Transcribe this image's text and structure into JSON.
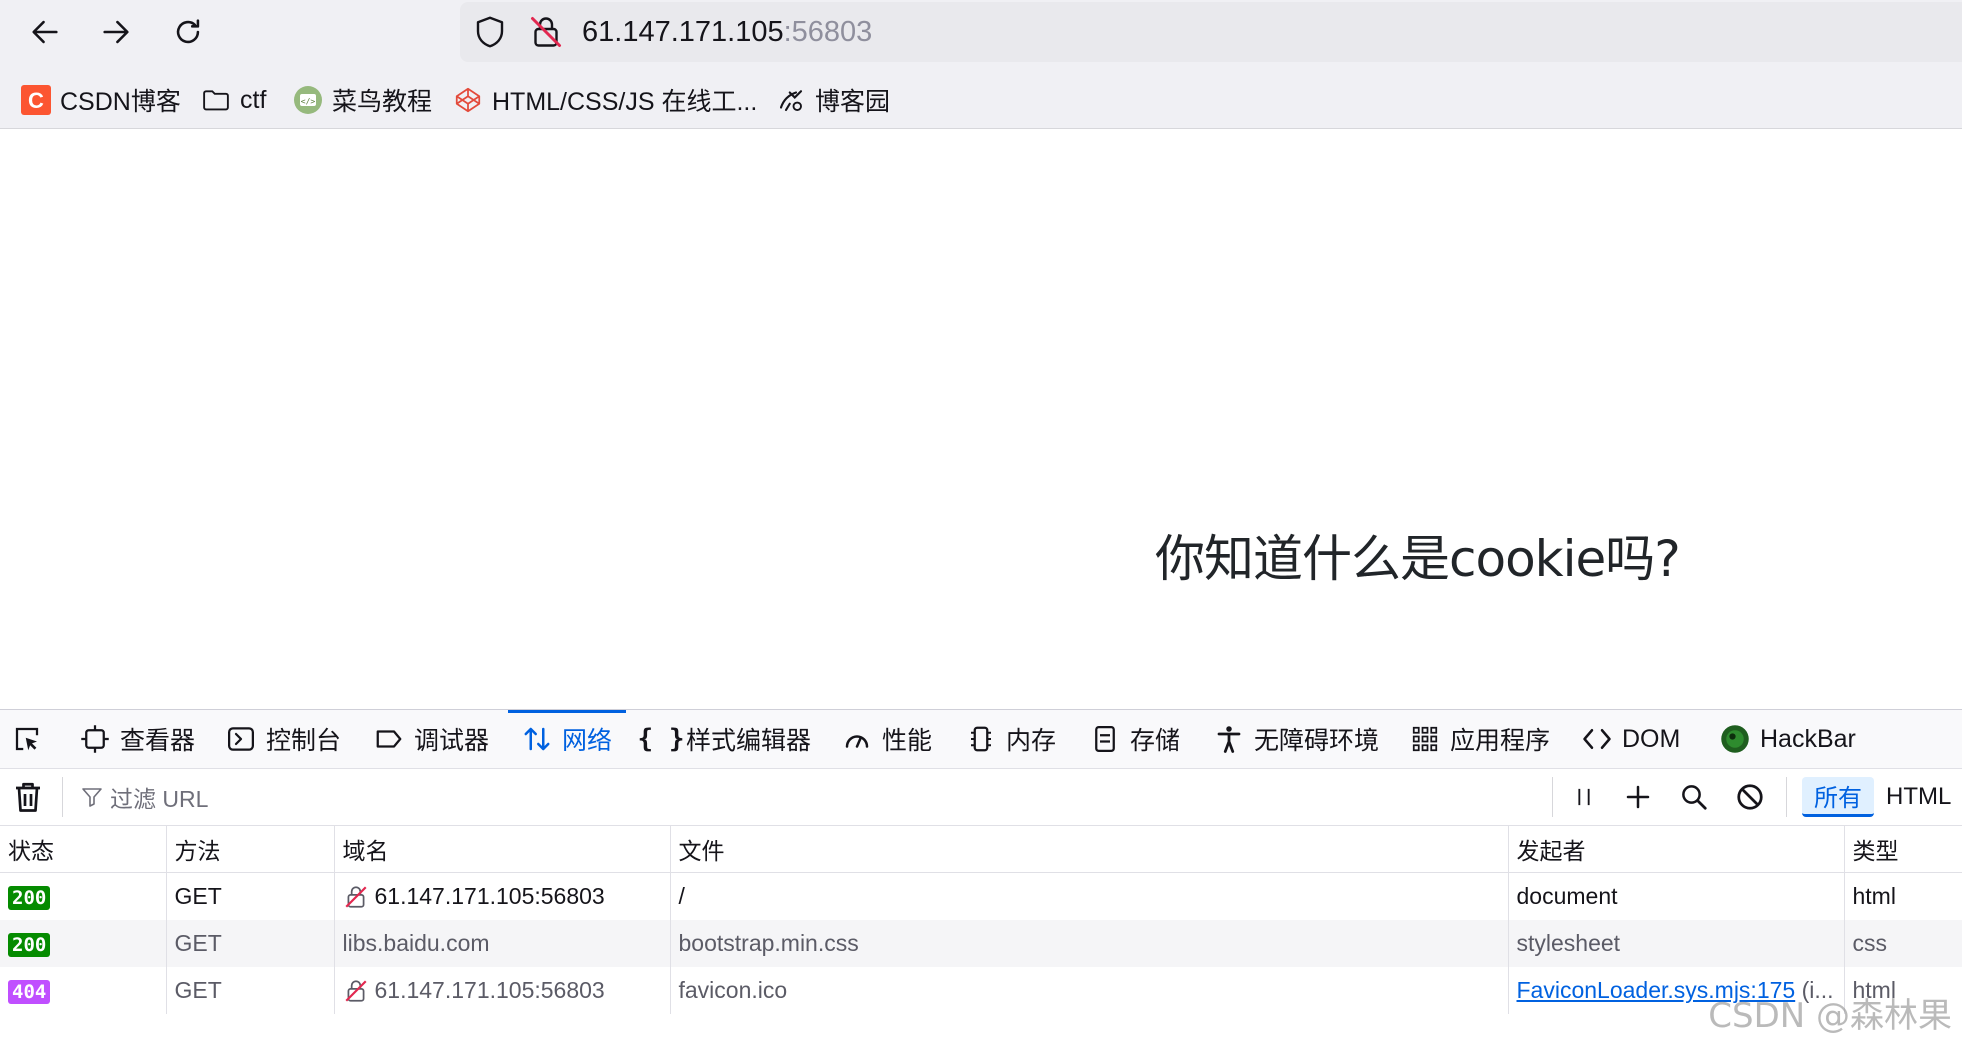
{
  "browser": {
    "url_host": "61.147.171.105",
    "url_port": ":56803",
    "bookmarks": [
      {
        "label": "CSDN博客",
        "icon": "csdn-logo-icon"
      },
      {
        "label": "ctf",
        "icon": "folder-icon"
      },
      {
        "label": "菜鸟教程",
        "icon": "runoob-logo-icon"
      },
      {
        "label": "HTML/CSS/JS 在线工...",
        "icon": "codepen-logo-icon"
      },
      {
        "label": "博客园",
        "icon": "cnblogs-logo-icon"
      }
    ]
  },
  "page": {
    "headline": "你知道什么是cookie吗?"
  },
  "devtools": {
    "tabs": [
      {
        "label": "",
        "icon": "element-picker-icon"
      },
      {
        "label": "查看器",
        "icon": "inspector-icon"
      },
      {
        "label": "控制台",
        "icon": "console-icon"
      },
      {
        "label": "调试器",
        "icon": "debugger-icon"
      },
      {
        "label": "网络",
        "icon": "network-icon",
        "active": true
      },
      {
        "label": "样式编辑器",
        "icon": "style-editor-icon"
      },
      {
        "label": "性能",
        "icon": "performance-icon"
      },
      {
        "label": "内存",
        "icon": "memory-icon"
      },
      {
        "label": "存储",
        "icon": "storage-icon"
      },
      {
        "label": "无障碍环境",
        "icon": "accessibility-icon"
      },
      {
        "label": "应用程序",
        "icon": "application-icon"
      },
      {
        "label": "DOM",
        "icon": "dom-icon"
      },
      {
        "label": "HackBar",
        "icon": "hackbar-icon"
      }
    ],
    "toolbar": {
      "filter_placeholder": "过滤 URL",
      "type_filters": [
        {
          "label": "所有",
          "active": true
        },
        {
          "label": "HTML",
          "active": false
        }
      ]
    },
    "columns": [
      "状态",
      "方法",
      "域名",
      "文件",
      "发起者",
      "类型"
    ],
    "requests": [
      {
        "status": "200",
        "method": "GET",
        "domain": "61.147.171.105:56803",
        "insecure": true,
        "file": "/",
        "initiator": "document",
        "initiator_link": false,
        "type": "html"
      },
      {
        "status": "200",
        "method": "GET",
        "domain": "libs.baidu.com",
        "insecure": false,
        "file": "bootstrap.min.css",
        "initiator": "stylesheet",
        "initiator_link": false,
        "type": "css"
      },
      {
        "status": "404",
        "method": "GET",
        "domain": "61.147.171.105:56803",
        "insecure": true,
        "file": "favicon.ico",
        "initiator": "FaviconLoader.sys.mjs:175",
        "initiator_suffix": " (i...",
        "initiator_link": true,
        "type": "html"
      }
    ],
    "colors": {
      "status_200": "#058b00",
      "status_404": "#c04fff",
      "accent": "#0061e0"
    }
  },
  "watermark": "CSDN @森林果"
}
